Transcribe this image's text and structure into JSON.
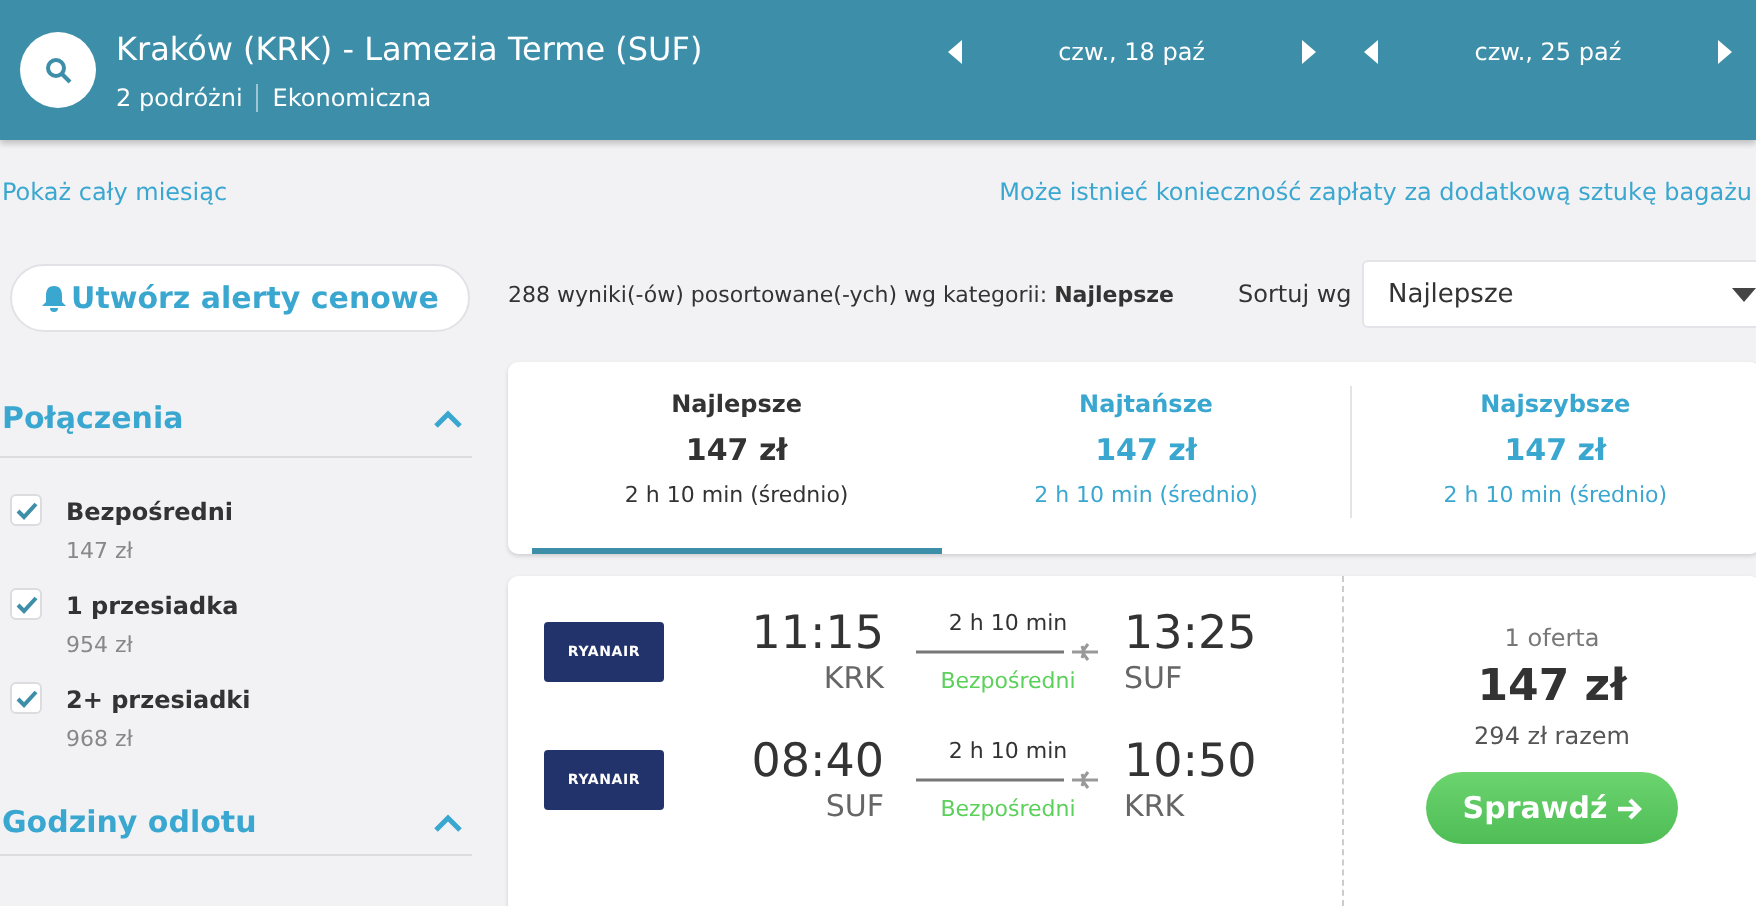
{
  "header": {
    "route": "Kraków (KRK) - Lamezia Terme (SUF)",
    "travellers": "2 podróżni",
    "cabin": "Ekonomiczna",
    "dates": [
      {
        "label": "czw., 18 paź"
      },
      {
        "label": "czw., 25 paź"
      }
    ]
  },
  "links": {
    "month": "Pokaż cały miesiąc",
    "baggage": "Może istnieć konieczność zapłaty za dodatkową sztukę bagażu"
  },
  "alert_button": "Utwórz alerty cenowe",
  "filters": [
    {
      "title": "Połączenia",
      "expanded": true,
      "options": [
        {
          "label": "Bezpośredni",
          "price": "147 zł",
          "checked": true
        },
        {
          "label": "1 przesiadka",
          "price": "954 zł",
          "checked": true
        },
        {
          "label": "2+ przesiadki",
          "price": "968 zł",
          "checked": true
        }
      ]
    },
    {
      "title": "Godziny odlotu",
      "expanded": true
    }
  ],
  "results_summary": {
    "text": "288 wyniki(-ów) posortowane(-ych) wg kategorii: ",
    "category": "Najlepsze"
  },
  "sort": {
    "label": "Sortuj wg",
    "value": "Najlepsze"
  },
  "tabs": [
    {
      "label": "Najlepsze",
      "price": "147 zł",
      "duration": "2 h 10 min (średnio)",
      "selected": true
    },
    {
      "label": "Najtańsze",
      "price": "147 zł",
      "duration": "2 h 10 min (średnio)",
      "selected": false
    },
    {
      "label": "Najszybsze",
      "price": "147 zł",
      "duration": "2 h 10 min (średnio)",
      "selected": false
    }
  ],
  "result": {
    "legs": [
      {
        "airline": "RYANAIR",
        "depart_time": "11:15",
        "depart_code": "KRK",
        "duration": "2 h 10 min",
        "stops": "Bezpośredni",
        "arrive_time": "13:25",
        "arrive_code": "SUF"
      },
      {
        "airline": "RYANAIR",
        "depart_time": "08:40",
        "depart_code": "SUF",
        "duration": "2 h 10 min",
        "stops": "Bezpośredni",
        "arrive_time": "10:50",
        "arrive_code": "KRK"
      }
    ],
    "offers": "1 oferta",
    "price": "147 zł",
    "total": "294 zł razem",
    "button": "Sprawdź"
  }
}
